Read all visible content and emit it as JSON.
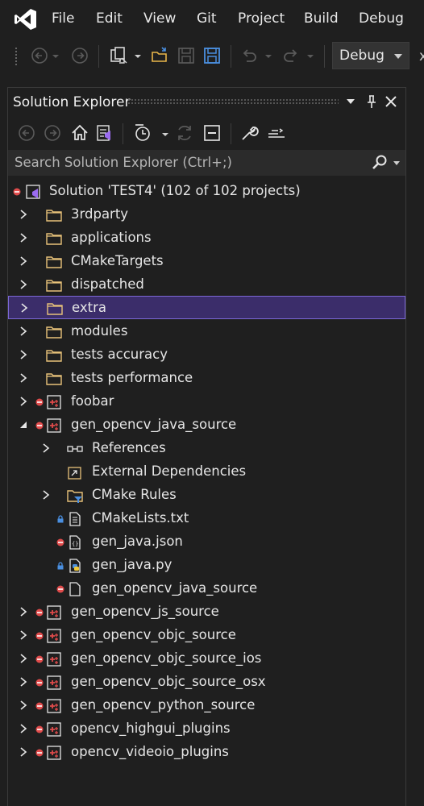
{
  "menu": {
    "items": [
      "File",
      "Edit",
      "View",
      "Git",
      "Project",
      "Build",
      "Debug"
    ]
  },
  "toolbar": {
    "configuration": "Debug",
    "overflow_label": "x"
  },
  "panel": {
    "title": "Solution Explorer",
    "search_placeholder": "Search Solution Explorer (Ctrl+;)"
  },
  "tree": {
    "solution": "Solution 'TEST4' (102 of 102 projects)",
    "folders": [
      "3rdparty",
      "applications",
      "CMakeTargets",
      "dispatched",
      "extra",
      "modules",
      "tests accuracy",
      "tests performance"
    ],
    "projects": {
      "foobar": "foobar",
      "gen_java": "gen_opencv_java_source",
      "others": [
        "gen_opencv_js_source",
        "gen_opencv_objc_source",
        "gen_opencv_objc_source_ios",
        "gen_opencv_objc_source_osx",
        "gen_opencv_python_source",
        "opencv_highgui_plugins",
        "opencv_videoio_plugins"
      ]
    },
    "children": [
      "References",
      "External Dependencies",
      "CMake Rules",
      "CMakeLists.txt",
      "gen_java.json",
      "gen_java.py",
      "gen_opencv_java_source"
    ]
  },
  "colors": {
    "selection_bg": "#3b2d6a",
    "selection_border": "#7b68d6",
    "error_red": "#e04b4b",
    "lock_blue": "#4a8fe0",
    "folder_outline": "#e8c27a",
    "vs_purple": "#9b6cf0"
  },
  "icons": {
    "folder": "folder-icon",
    "project": "cpp-project-icon",
    "solution": "solution-icon",
    "status_error": "red-circle-minus-icon",
    "status_lock": "lock-icon"
  }
}
